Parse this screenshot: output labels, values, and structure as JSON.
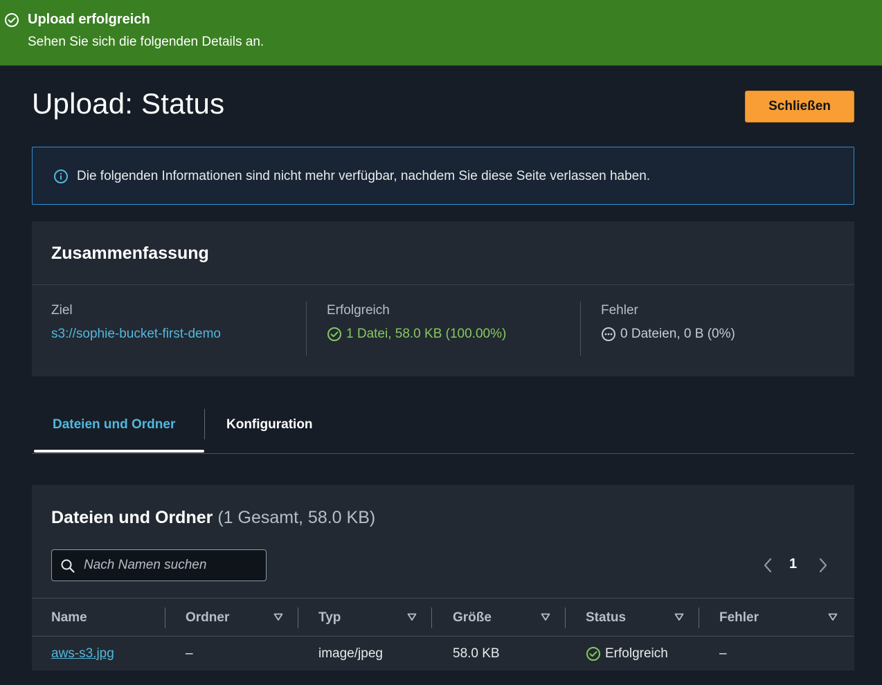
{
  "flash": {
    "title": "Upload erfolgreich",
    "message": "Sehen Sie sich die folgenden Details an.",
    "color": "#3a7f22"
  },
  "header": {
    "title": "Upload: Status",
    "close_label": "Schließen"
  },
  "info": {
    "text": "Die folgenden Informationen sind nicht mehr verfügbar, nachdem Sie diese Seite verlassen haben."
  },
  "summary": {
    "title": "Zusammenfassung",
    "target_label": "Ziel",
    "target_value": "s3://sophie-bucket-first-demo",
    "success_label": "Erfolgreich",
    "success_value": "1 Datei, 58.0 KB (100.00%)",
    "error_label": "Fehler",
    "error_value": "0 Dateien, 0 B (0%)"
  },
  "tabs": [
    {
      "label": "Dateien und Ordner",
      "active": true
    },
    {
      "label": "Konfiguration",
      "active": false
    }
  ],
  "files": {
    "title": "Dateien und Ordner",
    "count": "(1 Gesamt, 58.0 KB)",
    "search_placeholder": "Nach Namen suchen",
    "page": "1",
    "columns": [
      "Name",
      "Ordner",
      "Typ",
      "Größe",
      "Status",
      "Fehler"
    ],
    "rows": [
      {
        "name": "aws-s3.jpg",
        "folder": "–",
        "type": "image/jpeg",
        "size": "58.0 KB",
        "status": "Erfolgreich",
        "error": "–"
      }
    ]
  },
  "colors": {
    "accent_orange": "#f89e34",
    "link_blue": "#53b7dd",
    "success_green": "#85c95f",
    "background": "#161d26"
  }
}
